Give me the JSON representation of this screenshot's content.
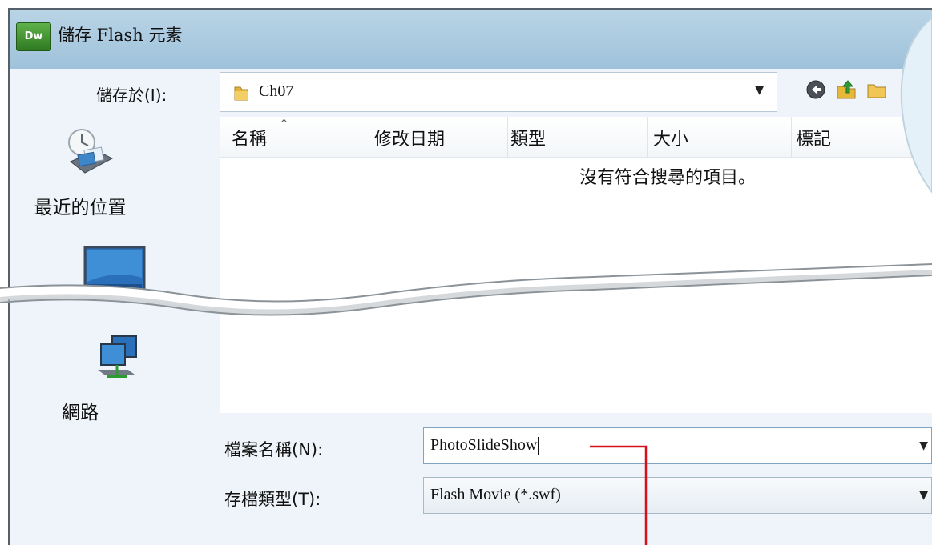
{
  "title_bar": {
    "app_icon_text": "Dw",
    "title": "儲存 Flash 元素"
  },
  "save_in": {
    "label": "儲存於(I):",
    "value": "Ch07"
  },
  "places": [
    {
      "label": "最近的位置",
      "icon": "recent-places-icon"
    },
    {
      "label": "",
      "icon": "desktop-icon"
    },
    {
      "label": "網路",
      "icon": "network-icon"
    }
  ],
  "file_list": {
    "columns": [
      "名稱",
      "修改日期",
      "類型",
      "大小",
      "標記"
    ],
    "empty_message": "沒有符合搜尋的項目。"
  },
  "file_name": {
    "label": "檔案名稱(N):",
    "value": "PhotoSlideShow"
  },
  "file_type": {
    "label": "存檔類型(T):",
    "value": "Flash Movie (*.swf)"
  },
  "colors": {
    "title_bar": "#a9c9df",
    "annotation": "#d4121e",
    "dialog_bg": "#eef4f9"
  }
}
